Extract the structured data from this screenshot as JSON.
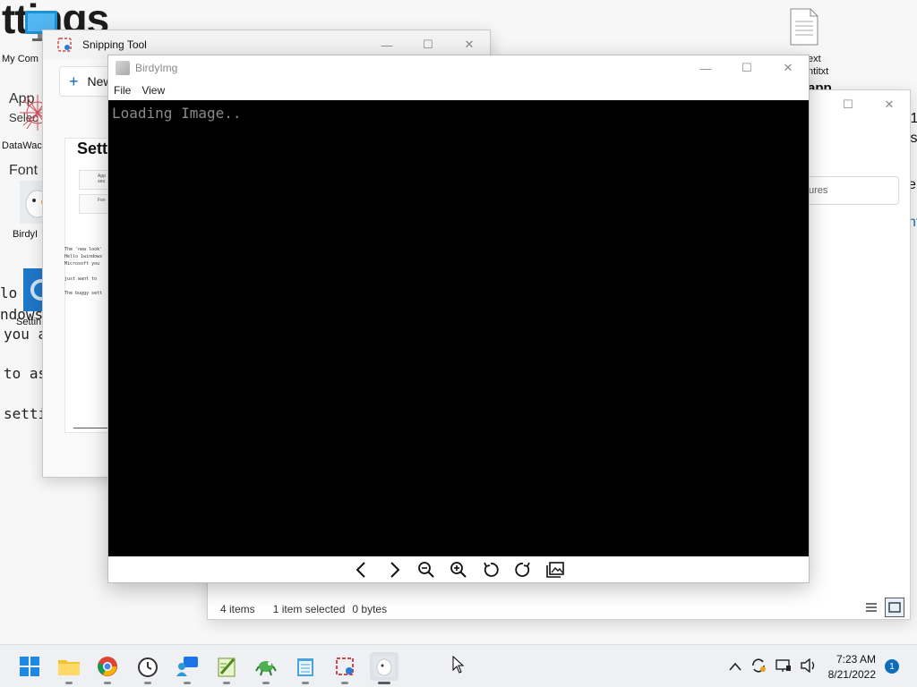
{
  "background_doc": {
    "big_title": "ttings",
    "app_label": "App",
    "select_label": "Selec",
    "font_label": "Font",
    "line_lo": "lo",
    "line_windows": "ndows",
    "line_you": "you a",
    "line_to": "to as",
    "line_setti": "setti"
  },
  "desktop": {
    "my_computer": "My Com",
    "datawag": "DataWac",
    "birdy": "BirdyI",
    "settings": "Settin",
    "text_label": "ext",
    "text_file": "ntitxt",
    "app_label": "app",
    "right_edge_1": ".1",
    "right_edge_2": "ts",
    "right_edge_3": "e",
    "right_edge_4": "nt"
  },
  "snipping_tool": {
    "title": "Snipping Tool",
    "new_label": "New",
    "doc_title": "Sett",
    "row1": "App sea",
    "row2": "Fon",
    "text_lines": [
      "The 'new look'",
      "Hello 1windows",
      "Microsoft you",
      "",
      "just want to",
      "",
      "The buggy sett"
    ]
  },
  "explorer": {
    "search_placeholder": "ures",
    "status_items": "4 items",
    "status_selected": "1 item selected",
    "status_size": "0 bytes"
  },
  "birdyimg": {
    "title": "BirdyImg",
    "menu": [
      "File",
      "View"
    ],
    "loading_text": "Loading Image..",
    "toolbar_icons": [
      "chevron-left-icon",
      "chevron-right-icon",
      "zoom-out-icon",
      "zoom-in-icon",
      "rotate-left-icon",
      "rotate-right-icon",
      "gallery-icon"
    ]
  },
  "taskbar": {
    "apps": [
      "start-icon",
      "file-explorer-icon",
      "chrome-icon",
      "clock-app-icon",
      "people-chat-icon",
      "notepad-plus-icon",
      "gecko-app-icon",
      "notepad-icon",
      "snipping-tool-icon",
      "birdyimg-icon"
    ],
    "time": "7:23 AM",
    "date": "8/21/2022",
    "notification_count": "1"
  },
  "colors": {
    "accent": "#0f6cbd",
    "canvas": "#000000",
    "loading_text": "#8a8a8a"
  }
}
